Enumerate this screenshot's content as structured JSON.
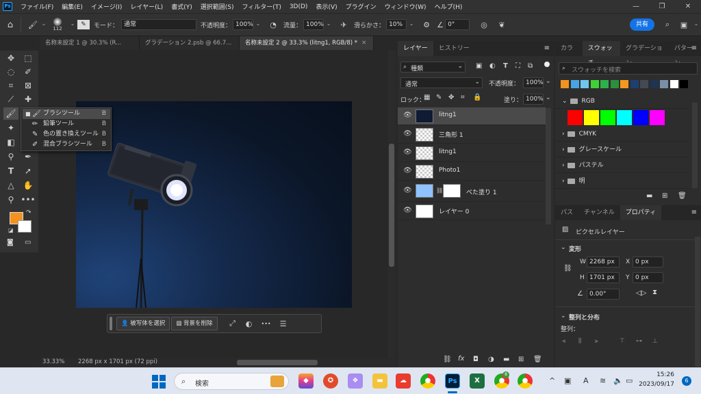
{
  "app": {
    "logo": "Ps"
  },
  "menu": [
    "ファイル(F)",
    "編集(E)",
    "イメージ(I)",
    "レイヤー(L)",
    "書式(Y)",
    "選択範囲(S)",
    "フィルター(T)",
    "3D(D)",
    "表示(V)",
    "プラグイン",
    "ウィンドウ(W)",
    "ヘルプ(H)"
  ],
  "window_controls": {
    "minimize": "—",
    "restore": "❐",
    "close": "✕"
  },
  "options": {
    "brush_size": "112",
    "mode_label": "モード：",
    "mode_value": "通常",
    "opacity_label": "不透明度：",
    "opacity_value": "100%",
    "flow_label": "流量：",
    "flow_value": "100%",
    "smoothing_label": "滑らかさ：",
    "smoothing_value": "10%",
    "angle_value": "0°",
    "share_label": "共有"
  },
  "tabs": [
    {
      "label": "名称未設定 1 @ 30.3% (R..."
    },
    {
      "label": "グラデーション 2.psb @ 66.7..."
    },
    {
      "label": "名称未設定 2 @ 33.3% (litng1, RGB/8) *"
    }
  ],
  "flyout": {
    "items": [
      {
        "label": "ブラシツール",
        "key": "B"
      },
      {
        "label": "鉛筆ツール",
        "key": "B"
      },
      {
        "label": "色の置き換えツール",
        "key": "B"
      },
      {
        "label": "混合ブラシツール",
        "key": "B"
      }
    ]
  },
  "contextbar": {
    "select_subject": "被写体を選択",
    "remove_bg": "背景を削除",
    "more": "•••"
  },
  "status": {
    "zoom": "33.33%",
    "doc_info": "2268 px x 1701 px (72 ppi)"
  },
  "layers": {
    "tabs": [
      "レイヤー",
      "ヒストリー"
    ],
    "filter_value": "種類",
    "blend_value": "通常",
    "opacity_label": "不透明度：",
    "opacity_value": "100%",
    "lock_label": "ロック：",
    "fill_label": "塗り：",
    "fill_value": "100%",
    "items": [
      {
        "name": "litng1"
      },
      {
        "name": "三角形 1"
      },
      {
        "name": "litng1"
      },
      {
        "name": "Photo1"
      },
      {
        "name": "べた塗り 1"
      },
      {
        "name": "レイヤー 0"
      }
    ]
  },
  "swatches": {
    "tabs": [
      "カラー",
      "スウォッチ",
      "グラデーション",
      "パターン"
    ],
    "search_placeholder": "スウォッチを検索",
    "recent_colors": [
      "#f2921f",
      "#4aa3e0",
      "#6fc7ec",
      "#3fd036",
      "#2eb04a",
      "#2b8f3d",
      "#f29a1f",
      "#1f3f6e",
      "#444a52",
      "#1f3352",
      "#7a8ea8",
      "#ffffff",
      "#000000"
    ],
    "groups": [
      {
        "name": "RGB"
      },
      {
        "name": "CMYK"
      },
      {
        "name": "グレースケール"
      },
      {
        "name": "パステル"
      },
      {
        "name": "明"
      }
    ],
    "rgb_colors": [
      "#ff0000",
      "#ffff00",
      "#00ff00",
      "#00ffff",
      "#0000ff",
      "#ff00ff"
    ]
  },
  "properties": {
    "tabs": [
      "パス",
      "チャンネル",
      "プロパティ"
    ],
    "kind": "ピクセルレイヤー",
    "transform_label": "変形",
    "w_label": "W",
    "w_value": "2268 px",
    "x_label": "X",
    "x_value": "0 px",
    "h_label": "H",
    "h_value": "1701 px",
    "y_label": "Y",
    "y_value": "0 px",
    "angle_value": "0.00°",
    "align_label": "整列と分布",
    "align_sub": "整列："
  },
  "taskbar": {
    "search_placeholder": "検索",
    "time": "15:26",
    "date": "2023/09/17",
    "notification_count": "6",
    "badge_count": "8"
  }
}
